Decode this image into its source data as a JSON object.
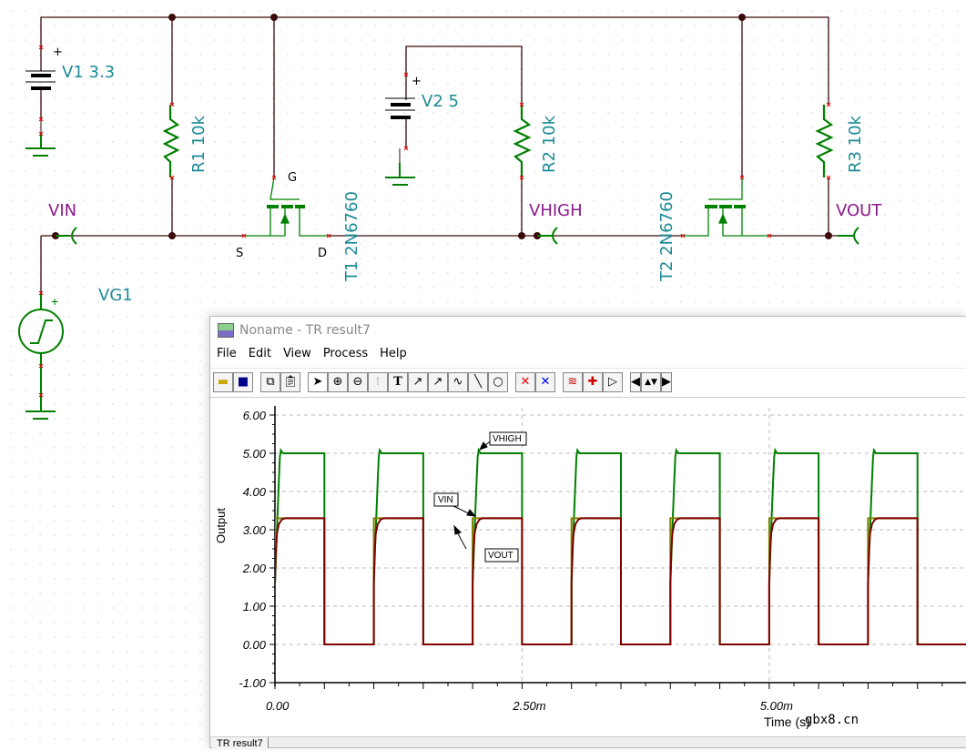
{
  "schematic": {
    "v1": "V1 3.3",
    "v2": "V2 5",
    "vg1": "VG1",
    "r1": "R1 10k",
    "r2": "R2 10k",
    "r3": "R3 10k",
    "t1": "T1 2N6760",
    "t2": "T2 2N6760",
    "pin_g": "G",
    "pin_s": "S",
    "pin_d": "D",
    "plus": "+",
    "nodes": {
      "vin": "VIN",
      "vhigh": "VHIGH",
      "vout": "VOUT"
    }
  },
  "window": {
    "title": "Noname - TR result7",
    "menu": [
      "File",
      "Edit",
      "View",
      "Process",
      "Help"
    ],
    "toolbar": [
      "open-icon",
      "save-icon",
      "copy-icon",
      "paste-icon",
      "pointer-icon",
      "zoom-in-icon",
      "zoom-100-icon",
      "grid-icon",
      "text-icon",
      "curve-label-icon",
      "curve-query-icon",
      "curve-formula-icon",
      "line-icon",
      "circle-icon",
      "cursor-a-icon",
      "cursor-b-icon",
      "add-curve-icon",
      "add-probe-icon",
      "marker-icon",
      "left-arrow-icon",
      "up-down-arrow-icon",
      "right-arrow-icon"
    ],
    "tab": "TR result7"
  },
  "watermark": "gbx8.cn",
  "chart_data": {
    "type": "line",
    "xlabel": "Time (s)",
    "ylabel": "Output",
    "xlim": [
      0,
      0.007
    ],
    "ylim": [
      -1,
      6
    ],
    "x_ticks": [
      "0.00",
      "2.50m",
      "5.00m"
    ],
    "x_tick_values": [
      0,
      0.0025,
      0.005
    ],
    "y_ticks": [
      "6.00",
      "5.00",
      "4.00",
      "3.00",
      "2.00",
      "1.00",
      "0.00",
      "-1.00"
    ],
    "grid": true,
    "period_s": 0.001,
    "series": [
      {
        "name": "VHIGH",
        "color": "#008000",
        "one_period": [
          [
            0,
            1.6
          ],
          [
            2e-05,
            3.0
          ],
          [
            4e-05,
            4.3
          ],
          [
            5e-05,
            4.9
          ],
          [
            6e-05,
            5.08
          ],
          [
            8e-05,
            5.0
          ],
          [
            0.0005,
            5.0
          ],
          [
            0.0005,
            0
          ],
          [
            0.001,
            0
          ]
        ]
      },
      {
        "name": "VIN",
        "color": "#808000",
        "one_period": [
          [
            0,
            1.6
          ],
          [
            0,
            3.3
          ],
          [
            0.0005,
            3.3
          ],
          [
            0.0005,
            0
          ],
          [
            0.001,
            0
          ]
        ]
      },
      {
        "name": "VOUT",
        "color": "#800000",
        "one_period": [
          [
            0,
            1.6
          ],
          [
            1e-05,
            2.5
          ],
          [
            2e-05,
            2.9
          ],
          [
            4e-05,
            3.15
          ],
          [
            7e-05,
            3.27
          ],
          [
            0.0001,
            3.3
          ],
          [
            0.0005,
            3.3
          ],
          [
            0.0005,
            0
          ],
          [
            0.001,
            0
          ]
        ]
      }
    ],
    "annotations": [
      "VHIGH",
      "VIN",
      "VOUT"
    ]
  }
}
